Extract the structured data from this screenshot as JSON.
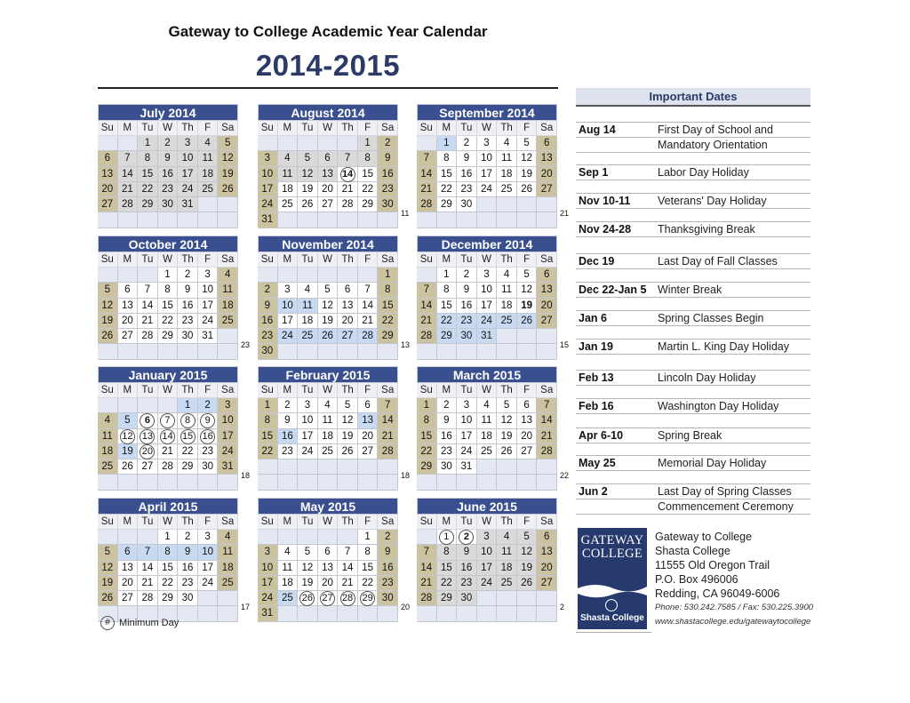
{
  "header": {
    "title": "Gateway to College Academic Year Calendar",
    "year": "2014-2015"
  },
  "weekdays": [
    "Su",
    "M",
    "Tu",
    "W",
    "Th",
    "F",
    "Sa"
  ],
  "colors": {
    "month_header": "#3a4f8f",
    "weekend": "#cbc3a0",
    "holiday": "#c7daf1",
    "school_day": "#ffffff",
    "summer": "#d9d9d9",
    "empty": "#e3e8f2",
    "title_blue": "#2b3a67"
  },
  "months": [
    {
      "name": "July 2014",
      "start": 2,
      "days": 31,
      "count": "",
      "summer": "1-31",
      "holidays": [],
      "circled": [],
      "bold": []
    },
    {
      "name": "August 2014",
      "start": 5,
      "days": 31,
      "count": "11",
      "summer": "1-13",
      "holidays": [],
      "circled": [
        14
      ],
      "bold": [
        14
      ]
    },
    {
      "name": "September 2014",
      "start": 1,
      "days": 30,
      "count": "21",
      "summer": "",
      "holidays": [
        1
      ],
      "circled": [],
      "bold": []
    },
    {
      "name": "October 2014",
      "start": 3,
      "days": 31,
      "count": "23",
      "summer": "",
      "holidays": [],
      "circled": [],
      "bold": []
    },
    {
      "name": "November 2014",
      "start": 6,
      "days": 30,
      "count": "13",
      "summer": "",
      "holidays": [
        10,
        11,
        24,
        25,
        26,
        27,
        28
      ],
      "circled": [],
      "bold": []
    },
    {
      "name": "December 2014",
      "start": 1,
      "days": 31,
      "count": "15",
      "summer": "",
      "holidays": [
        22,
        23,
        24,
        25,
        26,
        29,
        30,
        31
      ],
      "circled": [],
      "bold": [
        19
      ]
    },
    {
      "name": "January 2015",
      "start": 4,
      "days": 31,
      "count": "18",
      "summer": "",
      "holidays": [
        1,
        2,
        5,
        19
      ],
      "circled": [
        6,
        7,
        8,
        9,
        12,
        13,
        14,
        15,
        16,
        20
      ],
      "bold": [
        6
      ]
    },
    {
      "name": "February 2015",
      "start": 0,
      "days": 28,
      "count": "18",
      "summer": "",
      "holidays": [
        13,
        16
      ],
      "circled": [],
      "bold": []
    },
    {
      "name": "March 2015",
      "start": 0,
      "days": 31,
      "count": "22",
      "summer": "",
      "holidays": [],
      "circled": [],
      "bold": []
    },
    {
      "name": "April 2015",
      "start": 3,
      "days": 30,
      "count": "17",
      "summer": "",
      "holidays": [
        6,
        7,
        8,
        9,
        10
      ],
      "circled": [],
      "bold": []
    },
    {
      "name": "May 2015",
      "start": 5,
      "days": 31,
      "count": "20",
      "summer": "",
      "holidays": [
        25
      ],
      "circled": [
        26,
        27,
        28,
        29
      ],
      "bold": []
    },
    {
      "name": "June 2015",
      "start": 1,
      "days": 30,
      "count": "2",
      "summer": "3-30",
      "holidays": [],
      "circled": [
        1,
        2
      ],
      "bold": [
        2
      ]
    }
  ],
  "legend": {
    "symbol": "#",
    "label": "Minimum Day"
  },
  "important_dates": {
    "title": "Important Dates",
    "items": [
      {
        "date": "Aug 14",
        "lines": [
          "First Day of School and",
          "Mandatory Orientation"
        ]
      },
      {
        "date": "Sep 1",
        "lines": [
          "Labor Day Holiday"
        ]
      },
      {
        "date": "Nov 10-11",
        "lines": [
          "Veterans' Day Holiday"
        ]
      },
      {
        "date": "Nov 24-28",
        "lines": [
          "Thanksgiving Break"
        ]
      },
      {
        "date": "Dec 19",
        "lines": [
          "Last Day of Fall Classes"
        ]
      },
      {
        "date": "Dec 22-Jan 5",
        "lines": [
          "Winter Break"
        ]
      },
      {
        "date": "Jan 6",
        "lines": [
          "Spring Classes Begin"
        ]
      },
      {
        "date": "Jan 19",
        "lines": [
          "Martin L. King Day Holiday"
        ]
      },
      {
        "date": "Feb 13",
        "lines": [
          "Lincoln Day Holiday"
        ]
      },
      {
        "date": "Feb 16",
        "lines": [
          "Washington Day Holiday"
        ]
      },
      {
        "date": "Apr 6-10",
        "lines": [
          "Spring Break"
        ]
      },
      {
        "date": "May 25",
        "lines": [
          "Memorial Day Holiday"
        ]
      },
      {
        "date": "Jun 2",
        "lines": [
          "Last Day of Spring Classes",
          "Commencement Ceremony"
        ]
      }
    ]
  },
  "logo": {
    "line1": "GATEWAY",
    "line2": "COLLEGE",
    "sub": "Shasta College"
  },
  "contact": {
    "lines": [
      "Gateway to College",
      "Shasta College",
      "11555 Old Oregon Trail",
      "P.O. Box 496006",
      "Redding, CA 96049-6006"
    ],
    "phone": "Phone: 530.242.7585 / Fax: 530.225.3900",
    "web": "www.shastacollege.edu/gatewaytocollege"
  }
}
